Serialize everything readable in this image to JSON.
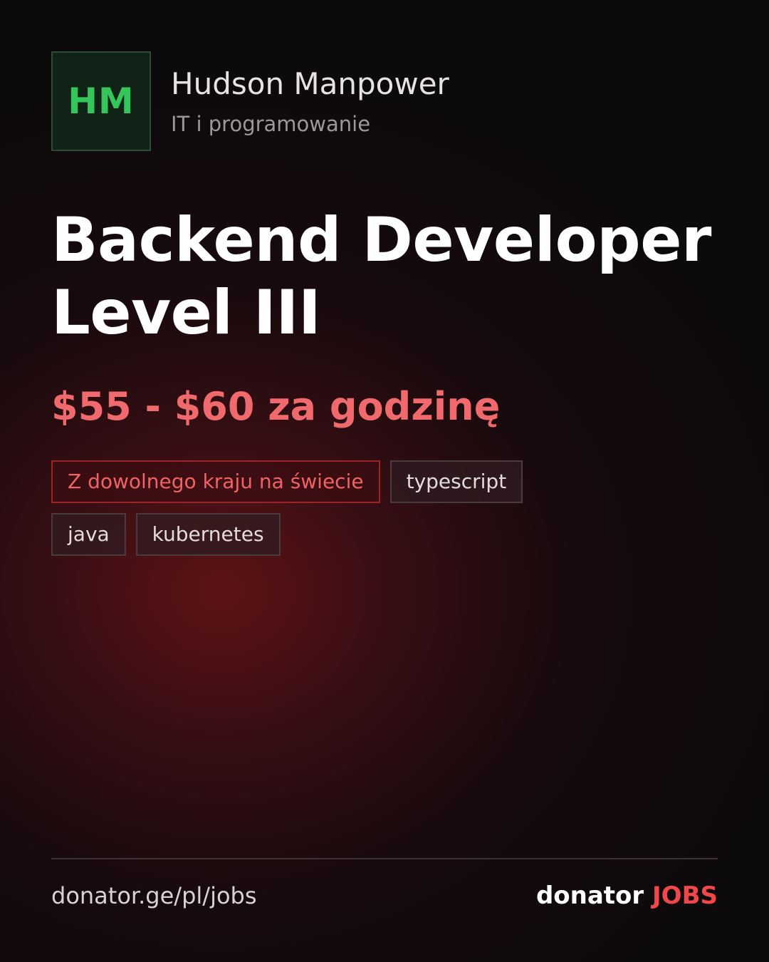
{
  "company": {
    "initials": "HM",
    "name": "Hudson Manpower",
    "category": "IT i programowanie"
  },
  "job": {
    "title_line1": "Backend Developer",
    "title_line2": "Level III",
    "salary": "$55 - $60 za godzinę"
  },
  "tags": [
    {
      "label": "Z dowolnego kraju na świecie",
      "kind": "location"
    },
    {
      "label": "typescript",
      "kind": "skill"
    },
    {
      "label": "java",
      "kind": "skill"
    },
    {
      "label": "kubernetes",
      "kind": "skill"
    }
  ],
  "footer": {
    "url": "donator.ge/pl/jobs",
    "brand_main": "donator",
    "brand_accent": "JOBS"
  },
  "colors": {
    "background": "#0b0a0b",
    "accent_red": "#f06a6d",
    "brand_red": "#f0474b",
    "logo_green": "#34c659",
    "logo_bg": "#112217"
  }
}
